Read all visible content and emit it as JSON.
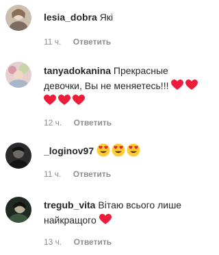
{
  "comments": [
    {
      "username": "lesia_dobra",
      "text": "Які",
      "time": "11 ч.",
      "reply_label": "Ответить",
      "avatar_colors": [
        "#c9bcae",
        "#8f7f74"
      ]
    },
    {
      "username": "tanyadokanina",
      "text": "Прекрасные девочки, Вы не меняетесь!!!",
      "time": "12 ч.",
      "reply_label": "Ответить",
      "emoji": [
        "red-heart",
        "red-heart",
        "red-heart",
        "red-heart",
        "red-heart"
      ],
      "avatar_colors": [
        "#d9b3b8",
        "#b8c7a3"
      ]
    },
    {
      "username": "_loginov97",
      "text": "",
      "time": "11 ч.",
      "reply_label": "Ответить",
      "emoji": [
        "heart-eyes-face",
        "heart-eyes-face",
        "heart-eyes-face"
      ],
      "avatar_colors": [
        "#1c1c1c",
        "#6b6b6b"
      ]
    },
    {
      "username": "tregub_vita",
      "text": "Вітаю всього лише найкращого",
      "time": "13 ч.",
      "reply_label": "Ответить",
      "emoji": [
        "red-heart"
      ],
      "avatar_colors": [
        "#2a3a2c",
        "#8fa88a"
      ]
    }
  ],
  "colors": {
    "text": "#262626",
    "meta": "#8e8e8e",
    "heart": "#ed1c3a",
    "emoji_face": "#ffcc33"
  }
}
